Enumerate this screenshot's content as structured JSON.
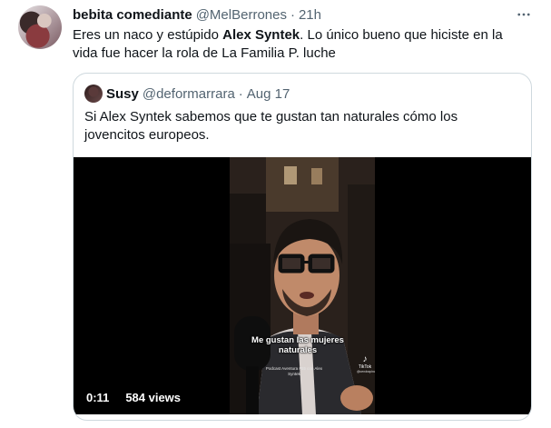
{
  "tweet": {
    "display_name": "bebita comediante",
    "handle": "@MelBerrones",
    "separator": "·",
    "time": "21h",
    "text_before": "Eres un naco y estúpido ",
    "text_bold": "Alex Syntek",
    "text_after": ". Lo único bueno que hiciste en la vida fue hacer la rola de La Familia P. luche",
    "more_icon": "more-horizontal-icon"
  },
  "quote": {
    "display_name": "Susy",
    "handle": "@deformarrara",
    "separator": "·",
    "time": "Aug 17",
    "text": "Si Alex Syntek sabemos que te gustan tan naturales cómo los jovencitos europeos.",
    "video": {
      "caption": "Me gustan las mujeres naturales",
      "podcast_label": "Podcast Aventura #55 con Alex Syntek",
      "tiktok_label": "TikTok",
      "tiktok_user": "@cendrapincedo",
      "duration": "0:11",
      "views": "584 views"
    }
  },
  "colors": {
    "text": "#0f1419",
    "secondary": "#536471",
    "border": "#cfd9de",
    "video_bg": "#000000"
  }
}
